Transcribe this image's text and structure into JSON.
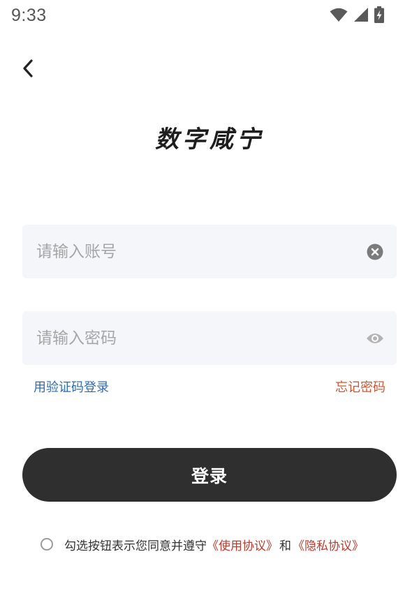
{
  "status_bar": {
    "time": "9:33",
    "icons": [
      "wifi-icon",
      "signal-icon",
      "battery-charging-icon"
    ]
  },
  "header": {
    "back_icon": "chevron-left-icon",
    "app_title": "数字咸宁"
  },
  "form": {
    "account": {
      "placeholder": "请输入账号",
      "value": "",
      "action_icon": "clear-icon"
    },
    "password": {
      "placeholder": "请输入密码",
      "value": "",
      "action_icon": "eye-icon"
    },
    "sms_login_link": "用验证码登录",
    "forgot_password_link": "忘记密码",
    "login_button": "登录"
  },
  "agreement": {
    "text": "勾选按钮表示您同意并遵守",
    "terms_link": "《使用协议》",
    "and": "和",
    "privacy_link": "《隐私协议》",
    "checked": false
  },
  "colors": {
    "primary_button": "#2f2f2f",
    "link_blue": "#2e6db4",
    "link_orange": "#d9542c",
    "link_red": "#c0392b",
    "field_background": "#f5f6fa"
  }
}
